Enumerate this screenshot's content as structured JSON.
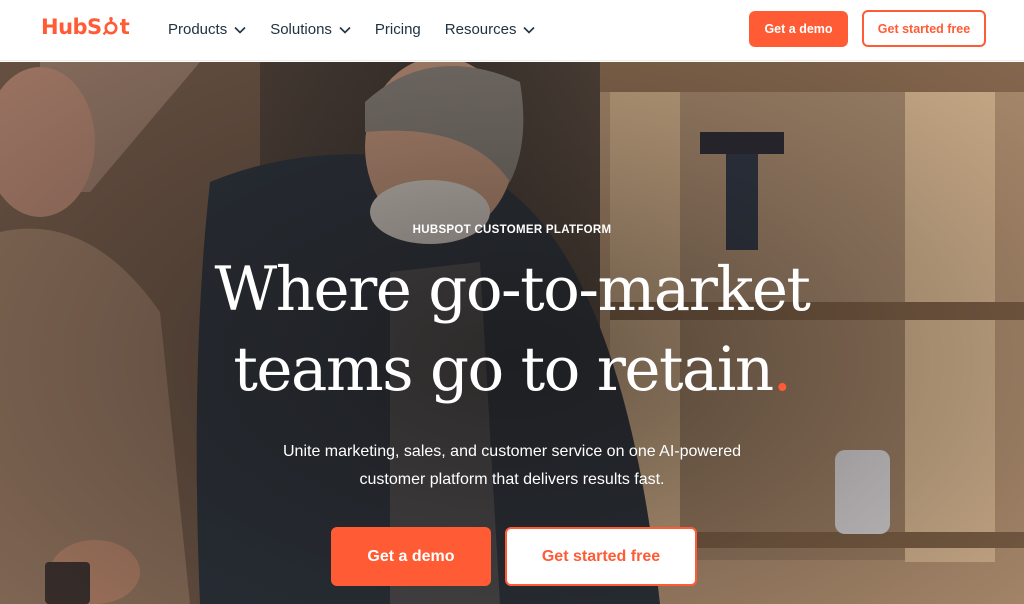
{
  "header": {
    "logo": {
      "part1": "HubS",
      "part2": "t",
      "icon": "sprocket-icon"
    },
    "nav": [
      {
        "label": "Products",
        "has_dropdown": true
      },
      {
        "label": "Solutions",
        "has_dropdown": true
      },
      {
        "label": "Pricing",
        "has_dropdown": false
      },
      {
        "label": "Resources",
        "has_dropdown": true
      }
    ],
    "cta_demo": "Get a demo",
    "cta_free": "Get started free"
  },
  "hero": {
    "eyebrow": "HUBSPOT CUSTOMER PLATFORM",
    "headline_line1": "Where go-to-market",
    "headline_line2": "teams go to retain",
    "headline_period": ".",
    "subhead": "Unite marketing, sales, and customer service on one AI-powered customer platform that delivers results fast.",
    "cta_demo": "Get a demo",
    "cta_free": "Get started free"
  },
  "colors": {
    "brand": "#ff5c35",
    "nav_text": "#213343",
    "hero_text": "#ffffff"
  }
}
